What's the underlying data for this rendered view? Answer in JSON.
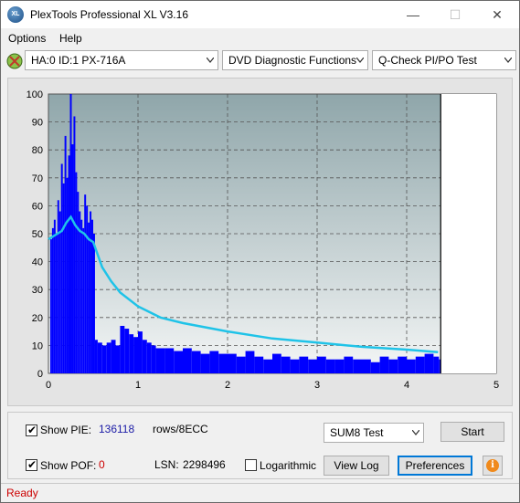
{
  "window": {
    "title": "PlexTools Professional XL V3.16",
    "app_icon_text": "XL",
    "minimize_glyph": "—",
    "maximize_glyph": "☐",
    "close_glyph": "✕"
  },
  "menu": [
    {
      "label": "Options"
    },
    {
      "label": "Help"
    }
  ],
  "toolbar": {
    "drive_select": "HA:0 ID:1  PX-716A",
    "function_select": "DVD Diagnostic Functions",
    "test_select": "Q-Check PI/PO Test"
  },
  "chart_data": {
    "type": "bar",
    "y_ticks": [
      "0",
      "10",
      "20",
      "30",
      "40",
      "50",
      "60",
      "70",
      "80",
      "90",
      "100"
    ],
    "x_ticks": [
      "0",
      "1",
      "2",
      "3",
      "4",
      "5"
    ],
    "ylim": [
      0,
      100
    ],
    "xlim": [
      0,
      5
    ],
    "grid": true,
    "plot_background": "#a9bcc0",
    "end_marker_x": 4.38,
    "series": [
      {
        "kind": "bars",
        "color": "#0000ff",
        "points": [
          [
            0.02,
            48
          ],
          [
            0.04,
            52
          ],
          [
            0.06,
            55
          ],
          [
            0.08,
            50
          ],
          [
            0.1,
            62
          ],
          [
            0.12,
            58
          ],
          [
            0.14,
            75
          ],
          [
            0.16,
            68
          ],
          [
            0.18,
            85
          ],
          [
            0.2,
            70
          ],
          [
            0.22,
            78
          ],
          [
            0.24,
            100
          ],
          [
            0.26,
            82
          ],
          [
            0.28,
            92
          ],
          [
            0.3,
            72
          ],
          [
            0.32,
            65
          ],
          [
            0.34,
            58
          ],
          [
            0.36,
            55
          ],
          [
            0.38,
            52
          ],
          [
            0.4,
            64
          ],
          [
            0.42,
            60
          ],
          [
            0.44,
            54
          ],
          [
            0.46,
            58
          ],
          [
            0.48,
            55
          ],
          [
            0.5,
            50
          ],
          [
            0.52,
            12
          ],
          [
            0.55,
            11
          ],
          [
            0.6,
            10
          ],
          [
            0.65,
            11
          ],
          [
            0.7,
            12
          ],
          [
            0.75,
            10
          ],
          [
            0.8,
            17
          ],
          [
            0.85,
            16
          ],
          [
            0.9,
            14
          ],
          [
            0.95,
            13
          ],
          [
            1.0,
            15
          ],
          [
            1.05,
            12
          ],
          [
            1.1,
            11
          ],
          [
            1.15,
            10
          ],
          [
            1.2,
            9
          ],
          [
            1.3,
            9
          ],
          [
            1.4,
            8
          ],
          [
            1.5,
            9
          ],
          [
            1.6,
            8
          ],
          [
            1.7,
            7
          ],
          [
            1.8,
            8
          ],
          [
            1.9,
            7
          ],
          [
            2.0,
            7
          ],
          [
            2.1,
            6
          ],
          [
            2.2,
            8
          ],
          [
            2.3,
            6
          ],
          [
            2.4,
            5
          ],
          [
            2.5,
            7
          ],
          [
            2.6,
            6
          ],
          [
            2.7,
            5
          ],
          [
            2.8,
            6
          ],
          [
            2.9,
            5
          ],
          [
            3.0,
            6
          ],
          [
            3.1,
            5
          ],
          [
            3.2,
            5
          ],
          [
            3.3,
            6
          ],
          [
            3.4,
            5
          ],
          [
            3.5,
            5
          ],
          [
            3.6,
            4
          ],
          [
            3.7,
            6
          ],
          [
            3.8,
            5
          ],
          [
            3.9,
            6
          ],
          [
            4.0,
            5
          ],
          [
            4.1,
            6
          ],
          [
            4.2,
            7
          ],
          [
            4.3,
            6
          ],
          [
            4.36,
            5
          ]
        ]
      },
      {
        "kind": "line",
        "color": "#1fc3e8",
        "points": [
          [
            0.0,
            48
          ],
          [
            0.05,
            49
          ],
          [
            0.1,
            50
          ],
          [
            0.15,
            51
          ],
          [
            0.2,
            54
          ],
          [
            0.25,
            56
          ],
          [
            0.3,
            53
          ],
          [
            0.35,
            51
          ],
          [
            0.4,
            50
          ],
          [
            0.45,
            48
          ],
          [
            0.5,
            47
          ],
          [
            0.6,
            38
          ],
          [
            0.7,
            33
          ],
          [
            0.8,
            29
          ],
          [
            1.0,
            24
          ],
          [
            1.25,
            20
          ],
          [
            1.5,
            18
          ],
          [
            1.75,
            16.5
          ],
          [
            2.0,
            15
          ],
          [
            2.5,
            12.5
          ],
          [
            3.0,
            11
          ],
          [
            3.5,
            9.5
          ],
          [
            4.0,
            8.5
          ],
          [
            4.35,
            7.6
          ]
        ]
      }
    ]
  },
  "controls": {
    "show_pie_label": "Show PIE:",
    "pie_value": "136118",
    "rows_label": "rows/8ECC",
    "show_pof_label": "Show POF:",
    "pof_value": "0",
    "lsn_label": "LSN:",
    "lsn_value": "2298496",
    "logarithmic_label": "Logarithmic",
    "test_mode_select": "SUM8 Test",
    "start_button": "Start",
    "view_log_button": "View Log",
    "preferences_button": "Preferences",
    "info_glyph": "i",
    "check_glyph": "✔"
  },
  "status": {
    "text": "Ready"
  }
}
